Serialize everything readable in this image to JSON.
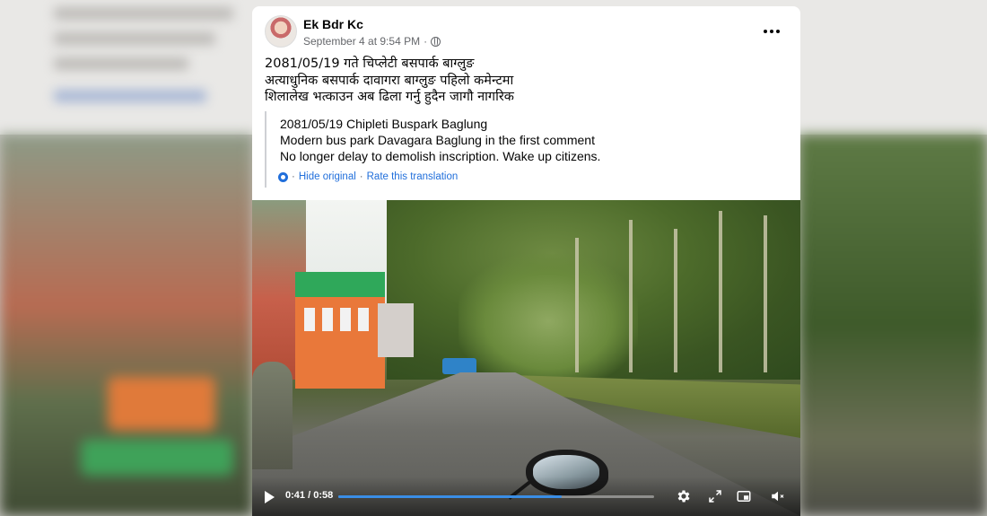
{
  "post": {
    "author": "Ek Bdr Kc",
    "timestamp": "September 4 at 9:54 PM",
    "separator": "·",
    "privacy_icon": "globe-icon",
    "more_icon": "more-options-icon",
    "text_lines": [
      "2081/05/19 गते चिप्लेटी बसपार्क बाग्लुङ",
      "अत्याधुनिक बसपार्क दावागरा बाग्लुङ पहिलो कमेन्टमा",
      "शिलालेख भत्काउन अब ढिला गर्नु हुदैन जागौ नागरिक"
    ],
    "translation": {
      "lines": [
        "2081/05/19 Chipleti Buspark Baglung",
        "Modern bus park Davagara Baglung in the first comment",
        "No longer delay to demolish inscription. Wake up citizens."
      ],
      "hide_original": "Hide original",
      "rate": "Rate this translation",
      "dot": "·"
    }
  },
  "video": {
    "current_time": "0:41",
    "duration": "0:58",
    "time_sep": " / ",
    "progress": 0.707,
    "accent": "#3a8ee6",
    "icons": [
      "play-icon",
      "settings-icon",
      "fullscreen-icon",
      "picture-in-picture-icon",
      "mute-icon"
    ]
  }
}
